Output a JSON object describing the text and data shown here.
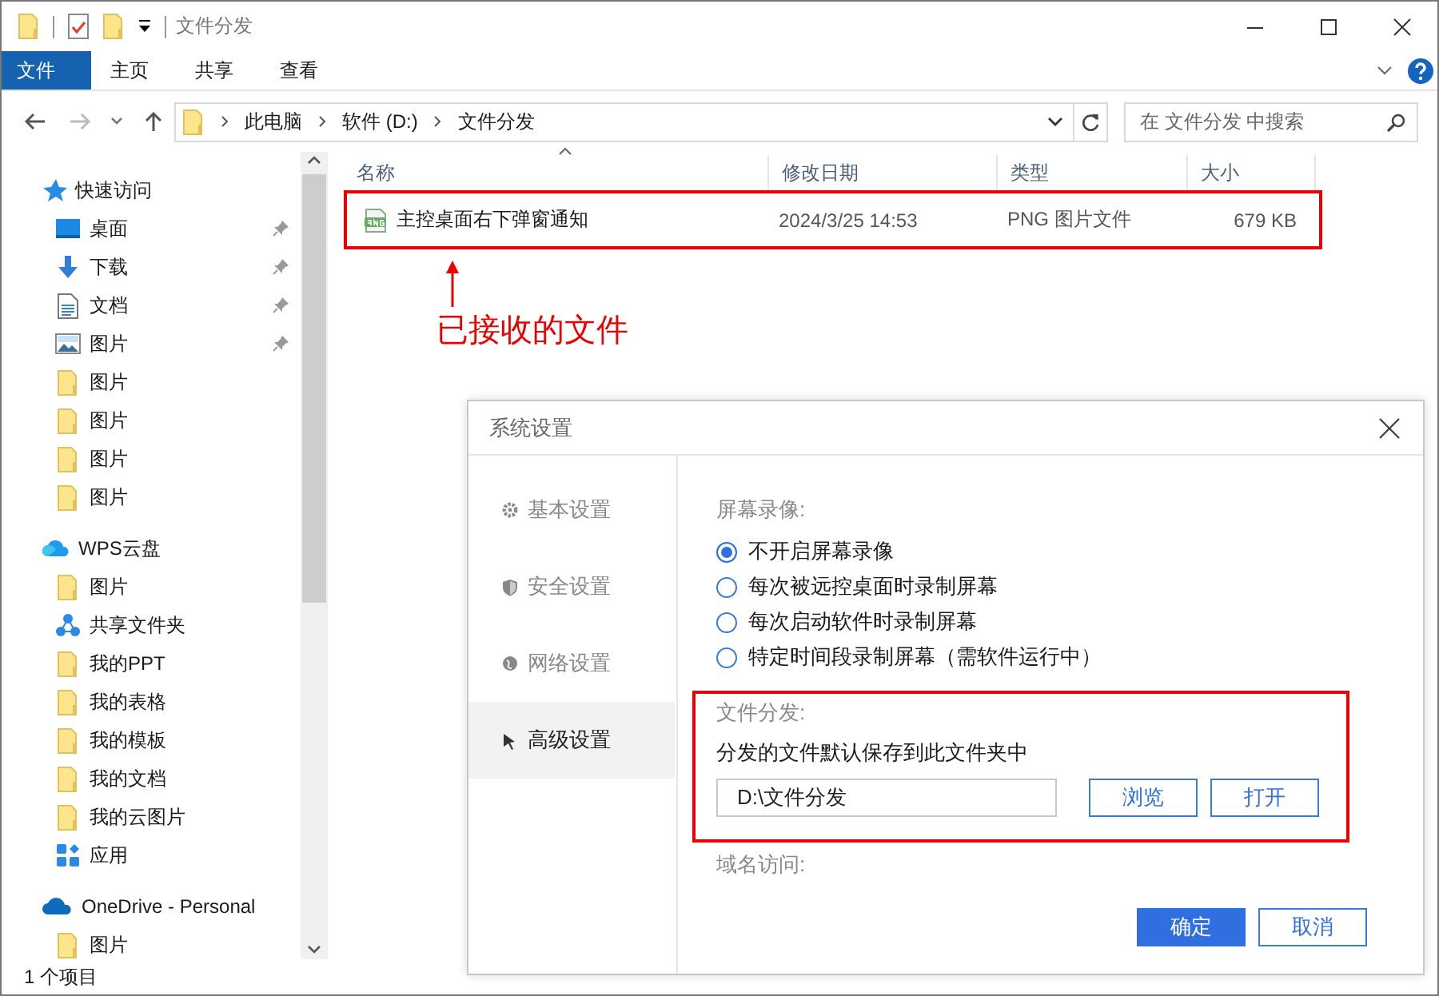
{
  "window": {
    "title": "文件分发"
  },
  "ribbon": {
    "tabs": [
      {
        "label": "文件",
        "selected": true
      },
      {
        "label": "主页",
        "selected": false
      },
      {
        "label": "共享",
        "selected": false
      },
      {
        "label": "查看",
        "selected": false
      }
    ]
  },
  "address": {
    "path": [
      "此电脑",
      "软件 (D:)",
      "文件分发"
    ]
  },
  "search": {
    "placeholder": "在 文件分发 中搜索"
  },
  "nav_pane": {
    "groups": [
      {
        "label": "快速访问",
        "kind": "star",
        "children": [
          {
            "label": "桌面",
            "kind": "desktop",
            "pinned": true
          },
          {
            "label": "下载",
            "kind": "download",
            "pinned": true
          },
          {
            "label": "文档",
            "kind": "document",
            "pinned": true
          },
          {
            "label": "图片",
            "kind": "pictures",
            "pinned": true
          },
          {
            "label": "图片",
            "kind": "folder",
            "pinned": false
          },
          {
            "label": "图片",
            "kind": "folder",
            "pinned": false
          },
          {
            "label": "图片",
            "kind": "folder",
            "pinned": false
          },
          {
            "label": "图片",
            "kind": "folder",
            "pinned": false
          }
        ]
      },
      {
        "label": "WPS云盘",
        "kind": "wps",
        "children": [
          {
            "label": "图片",
            "kind": "folder",
            "pinned": false
          },
          {
            "label": "共享文件夹",
            "kind": "share",
            "pinned": false
          },
          {
            "label": "我的PPT",
            "kind": "folder",
            "pinned": false
          },
          {
            "label": "我的表格",
            "kind": "folder",
            "pinned": false
          },
          {
            "label": "我的模板",
            "kind": "folder",
            "pinned": false
          },
          {
            "label": "我的文档",
            "kind": "folder",
            "pinned": false
          },
          {
            "label": "我的云图片",
            "kind": "folder",
            "pinned": false
          },
          {
            "label": "应用",
            "kind": "apps",
            "pinned": false
          }
        ]
      },
      {
        "label": "OneDrive - Personal",
        "kind": "cloud",
        "children": [
          {
            "label": "图片",
            "kind": "folder",
            "pinned": false
          }
        ]
      }
    ]
  },
  "file_list": {
    "columns": [
      "名称",
      "修改日期",
      "类型",
      "大小"
    ],
    "rows": [
      {
        "cells": [
          "主控桌面右下弹窗通知",
          "2024/3/25 14:53",
          "PNG 图片文件",
          "679 KB"
        ]
      }
    ]
  },
  "annotation": {
    "label": "已接收的文件"
  },
  "status_bar": {
    "text": "1 个项目"
  },
  "dialog": {
    "title": "系统设置",
    "nav": [
      {
        "label": "基本设置",
        "kind": "basic",
        "selected": false
      },
      {
        "label": "安全设置",
        "kind": "security",
        "selected": false
      },
      {
        "label": "网络设置",
        "kind": "network",
        "selected": false
      },
      {
        "label": "高级设置",
        "kind": "advanced",
        "selected": true
      }
    ],
    "screen_recording": {
      "label": "屏幕录像:",
      "options": [
        {
          "label": "不开启屏幕录像",
          "selected": true
        },
        {
          "label": "每次被远控桌面时录制屏幕",
          "selected": false
        },
        {
          "label": "每次启动软件时录制屏幕",
          "selected": false
        },
        {
          "label": "特定时间段录制屏幕（需软件运行中）",
          "selected": false
        }
      ]
    },
    "file_distribution": {
      "label": "文件分发:",
      "description": "分发的文件默认保存到此文件夹中",
      "value": "D:\\文件分发",
      "buttons": [
        "浏览",
        "打开"
      ]
    },
    "domain_label": "域名访问:",
    "buttons": [
      {
        "label": "确定",
        "kind": "primary"
      },
      {
        "label": "取消",
        "kind": "secondary"
      }
    ]
  }
}
